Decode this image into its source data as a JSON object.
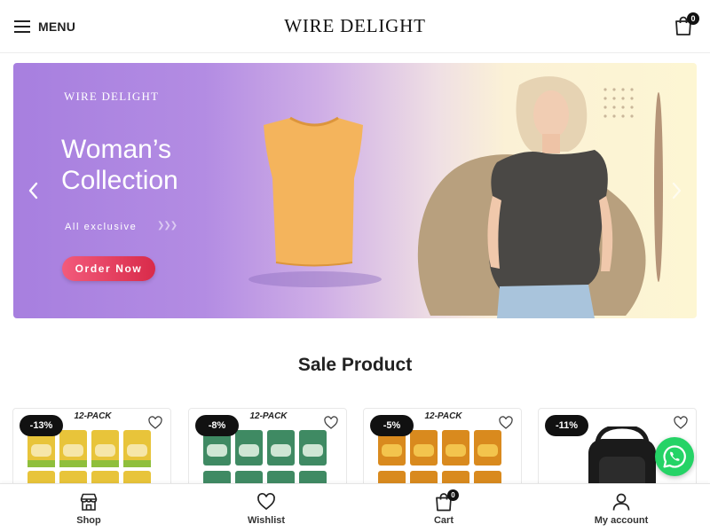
{
  "header": {
    "menu_label": "MENU",
    "logo": "WIRE DELIGHT",
    "cart_count": "0"
  },
  "banner": {
    "brand": "WIRE DELIGHT",
    "title": "Woman’s Collection",
    "subtitle": "All exclusive",
    "cta": "Order Now",
    "colors": {
      "gradient_start": "#a77fdf",
      "gradient_end": "#fdf6d3",
      "cta": "#e2365a"
    }
  },
  "sale": {
    "title": "Sale Product",
    "products": [
      {
        "discount": "-13%",
        "pack_label": "12-PACK",
        "bag_color": "#e8c43a",
        "bag_accent": "#8fbf3c"
      },
      {
        "discount": "-8%",
        "pack_label": "12-PACK",
        "bag_color": "#3f8a63",
        "bag_accent": "#cfe6d4"
      },
      {
        "discount": "-5%",
        "pack_label": "12-PACK",
        "bag_color": "#d98a1e",
        "bag_accent": "#f3c44d"
      },
      {
        "discount": "-11%",
        "pack_label": "",
        "bag_color": "#1b1b1b",
        "bag_accent": "#333333"
      }
    ]
  },
  "bottom_nav": {
    "shop": "Shop",
    "wishlist": "Wishlist",
    "cart": "Cart",
    "cart_count": "0",
    "account": "My account"
  },
  "icons": [
    "hamburger-icon",
    "shopping-bag-icon",
    "chevron-left-icon",
    "chevron-right-icon",
    "heart-icon",
    "store-icon",
    "user-icon",
    "whatsapp-icon"
  ]
}
